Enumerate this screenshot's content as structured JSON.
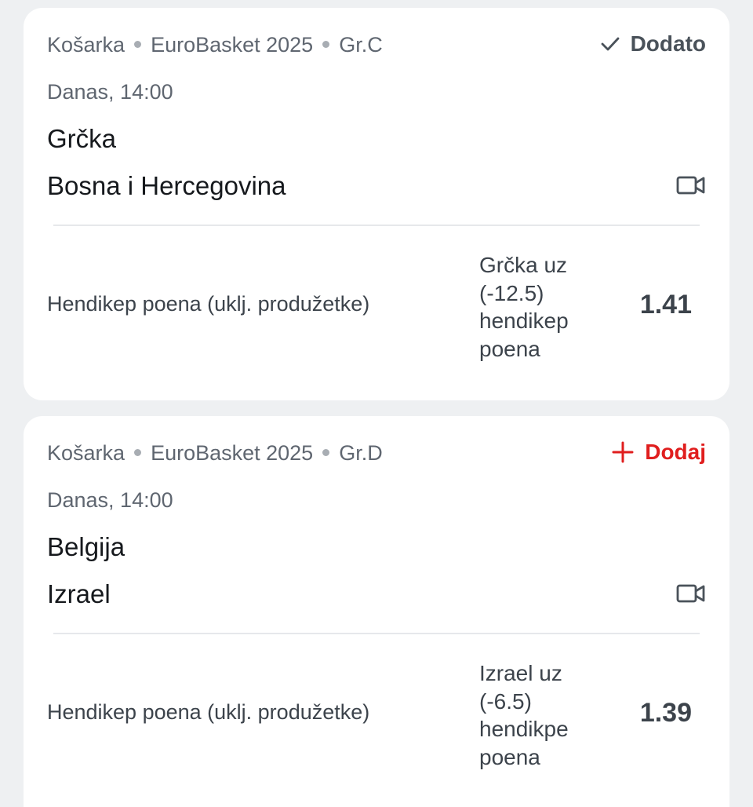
{
  "events": [
    {
      "sport": "Košarka",
      "competition": "EuroBasket 2025",
      "group": "Gr.C",
      "action_label": "Dodato",
      "time": "Danas, 14:00",
      "home_team": "Grčka",
      "away_team": "Bosna i Hercegovina",
      "market": "Hendikep poena (uklj. produžetke)",
      "selection": "Grčka uz (-12.5) hendikep poena",
      "odds": "1.41"
    },
    {
      "sport": "Košarka",
      "competition": "EuroBasket 2025",
      "group": "Gr.D",
      "action_label": "Dodaj",
      "time": "Danas, 14:00",
      "home_team": "Belgija",
      "away_team": "Izrael",
      "market": "Hendikep poena (uklj. produžetke)",
      "selection": "Izrael uz (-6.5) hendikpe poena",
      "odds": "1.39"
    }
  ],
  "icons": {
    "added": "checkmark-icon",
    "add": "plus-icon",
    "video": "video-camera-icon"
  },
  "colors": {
    "add_action": "#e01e1e",
    "added_action": "#4a525a",
    "background": "#eef0f2",
    "card": "#ffffff"
  }
}
